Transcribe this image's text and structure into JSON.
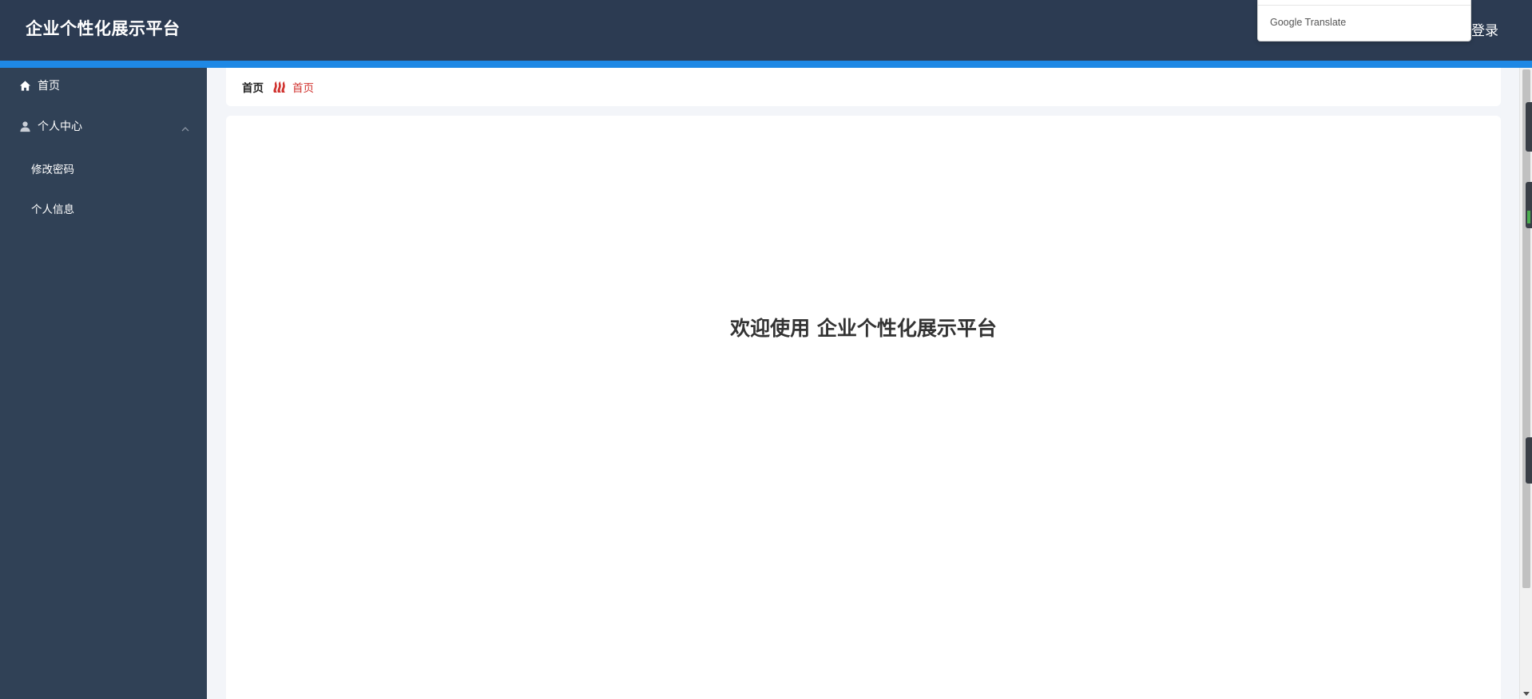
{
  "header": {
    "brand": "企业个性化展示平台",
    "login_label": "登录"
  },
  "translate_popup": {
    "label": "Google Translate"
  },
  "sidebar": {
    "items": [
      {
        "label": "首页",
        "icon": "home-icon"
      },
      {
        "label": "个人中心",
        "icon": "user-icon",
        "expanded": true
      },
      {
        "label": "修改密码"
      },
      {
        "label": "个人信息"
      }
    ]
  },
  "breadcrumb": {
    "home": "首页",
    "current": "首页",
    "separator_icon": "flame-separator-icon",
    "current_color": "#d0312d"
  },
  "main": {
    "welcome": "欢迎使用 企业个性化展示平台"
  },
  "colors": {
    "header_bg": "#2c3b52",
    "accent": "#1e88e5",
    "sidebar_bg": "#304156"
  }
}
